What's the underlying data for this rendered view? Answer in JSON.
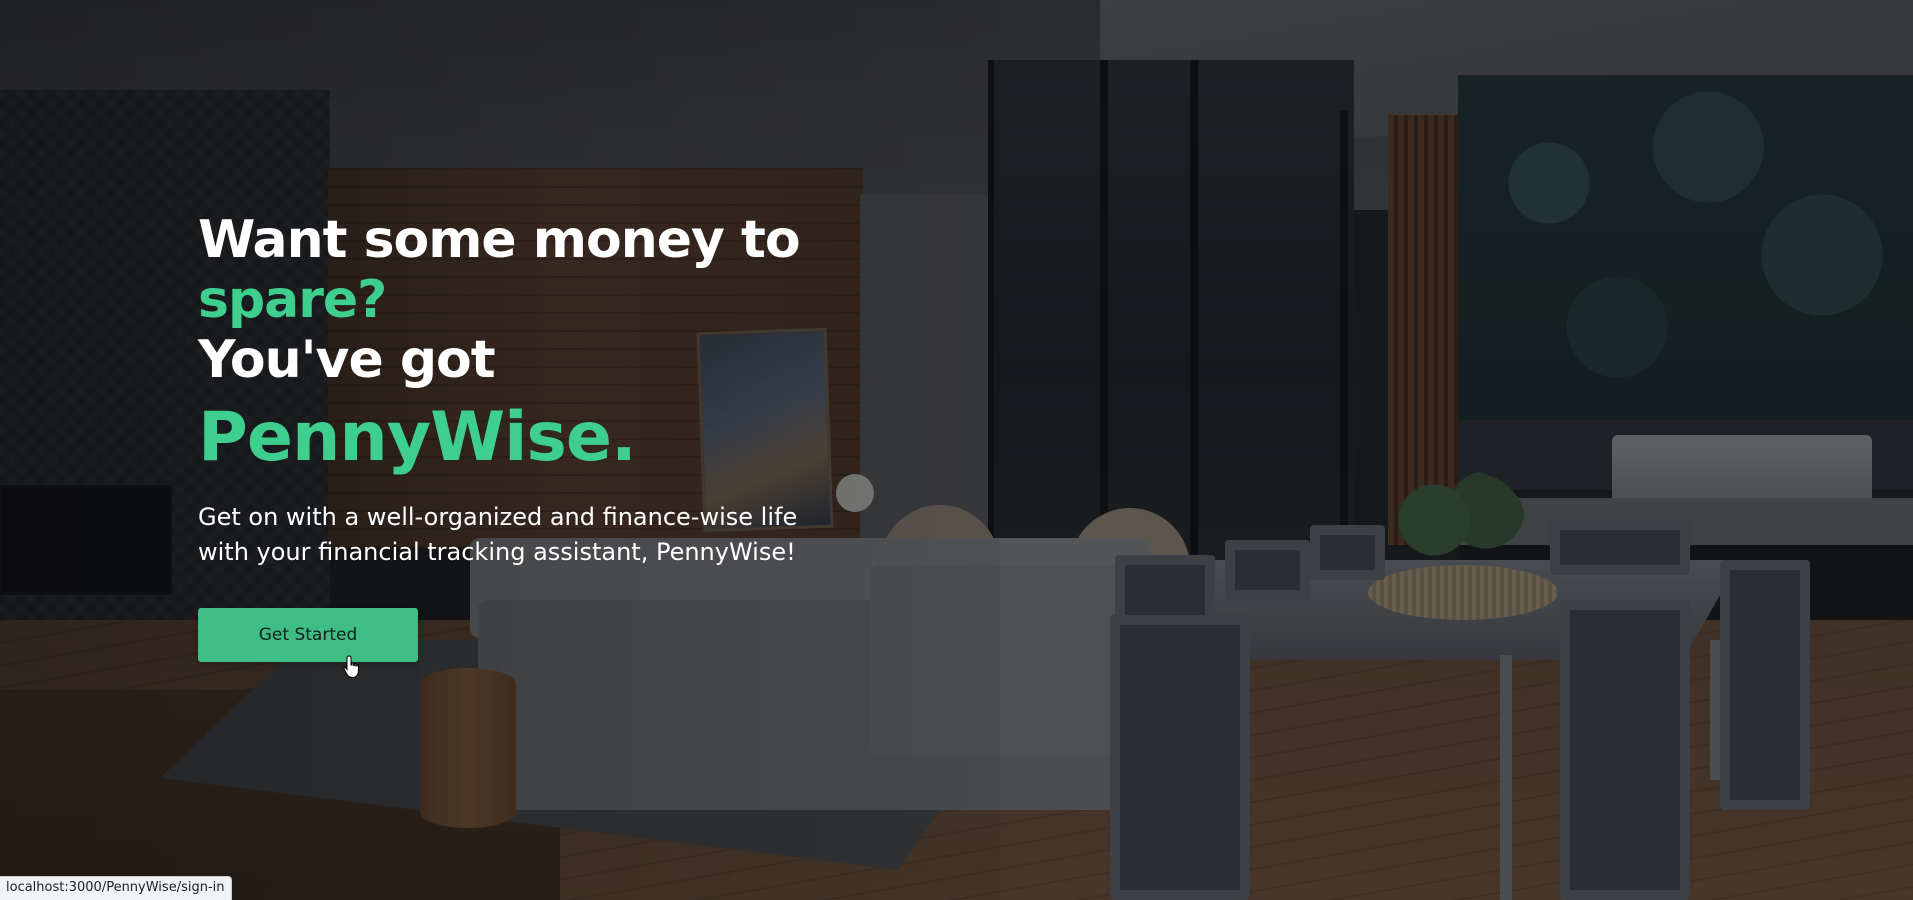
{
  "hero": {
    "line1": "Want some money to",
    "line2": "spare?",
    "line3": "You've got",
    "brand": "PennyWise.",
    "tagline_line1": "Get on with a well-organized and finance-wise life",
    "tagline_line2": "with your financial tracking assistant, PennyWise!",
    "cta_label": "Get Started"
  },
  "statusbar": {
    "url": "localhost:3000/PennyWise/sign-in"
  },
  "colors": {
    "accent": "#3ecf8e",
    "button": "#3ebd84",
    "text": "#ffffff"
  }
}
